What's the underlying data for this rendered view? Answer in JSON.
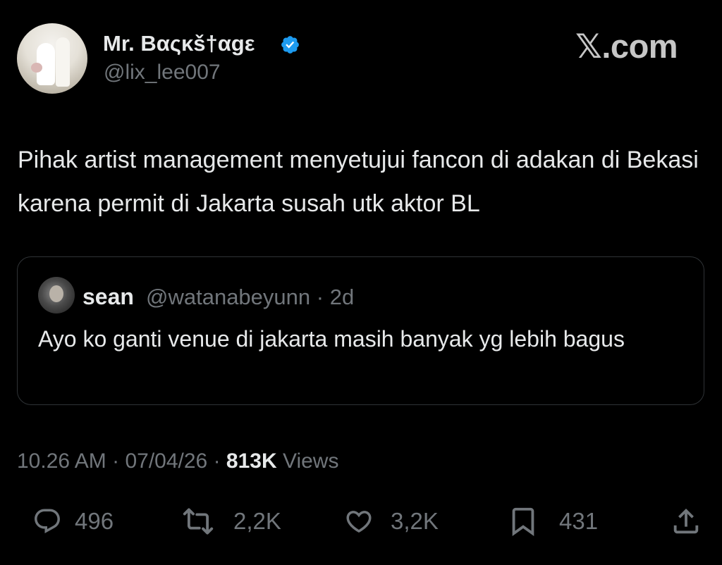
{
  "author": {
    "display_name": "Mr. Bαςκš†αgε",
    "handle": "@lix_lee007",
    "verified": true
  },
  "site": "𝕏.com",
  "tweet": {
    "text": "Pihak artist management menyetujui fancon di adakan di Bekasi karena permit di Jakarta susah utk aktor BL"
  },
  "quote": {
    "name": "sean",
    "handle": "@watanabeyunn",
    "separator": "·",
    "age": "2d",
    "text": "Ayo ko ganti venue di jakarta masih banyak yg lebih bagus"
  },
  "meta": {
    "time": "10.26 AM",
    "sep1": "·",
    "date": "07/04/26",
    "sep2": "·",
    "views_count": "813K",
    "views_label": "Views"
  },
  "actions": {
    "replies": "496",
    "reposts": "2,2K",
    "likes": "3,2K",
    "bookmarks": "431"
  },
  "colors": {
    "background": "#000000",
    "text": "#e7e9ea",
    "muted": "#71767b",
    "verified": "#1d9bf0",
    "border": "#2f3336"
  },
  "icons": [
    "verified-badge-icon",
    "reply-icon",
    "repost-icon",
    "like-icon",
    "bookmark-icon",
    "share-icon"
  ]
}
